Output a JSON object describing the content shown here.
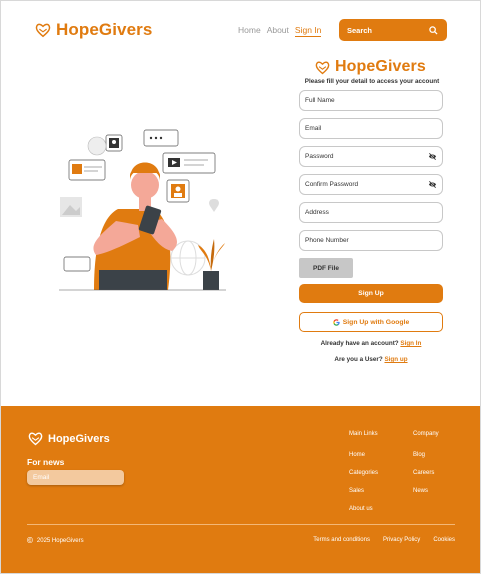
{
  "brand": {
    "name": "HopeGivers",
    "accent": "#e07b10"
  },
  "header": {
    "nav": [
      {
        "label": "Home"
      },
      {
        "label": "About"
      },
      {
        "label": "Sign In"
      }
    ],
    "search": {
      "placeholder": "Search",
      "icon": "search-icon"
    }
  },
  "form": {
    "title": "HopeGivers",
    "subtitle": "Please fill your detail to access your account",
    "fields": {
      "full_name": "Full Name",
      "email": "Email",
      "password": "Password",
      "confirm_password": "Confirm Password",
      "address": "Address",
      "phone": "Phone Number"
    },
    "pdf_label": "PDF File",
    "signup_label": "Sign Up",
    "google_label": "Sign Up with Google",
    "have_account": "Already have an account?",
    "signin_link": "Sign In",
    "are_user": "Are you a User?",
    "user_signup_link": "Sign up"
  },
  "footer": {
    "brand": "HopeGivers",
    "news_title": "For news",
    "email_placeholder": "Email",
    "col1": {
      "head": "Main Links",
      "items": [
        "Home",
        "Categories",
        "Sales",
        "About us"
      ]
    },
    "col2": {
      "head": "Company",
      "items": [
        "Blog",
        "Careers",
        "News"
      ]
    },
    "copyright_symbol": "©",
    "copyright": "2025 HopeGivers",
    "links": [
      "Terms and conditions",
      "Privacy Policy",
      "Cookies"
    ]
  }
}
